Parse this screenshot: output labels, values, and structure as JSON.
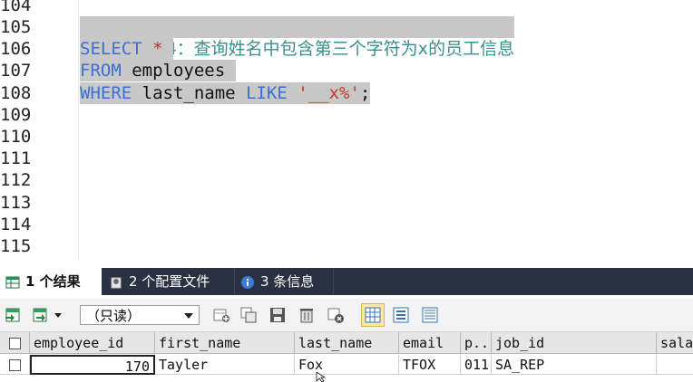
{
  "editor": {
    "line_numbers": [
      "104",
      "105",
      "106",
      "107",
      "108",
      "109",
      "110",
      "111",
      "112",
      "113",
      "114",
      "115"
    ],
    "lines": {
      "comment": "#案例4：查询姓名中包含第三个字符为x的员工信息",
      "select_kw": "SELECT",
      "select_star": "*",
      "from_kw": "FROM",
      "from_table": "employees",
      "where_kw": "WHERE",
      "where_col": "last_name",
      "like_kw": "LIKE",
      "like_str": "'__x%'",
      "semicolon": ";"
    }
  },
  "result_tabs": [
    {
      "label": "1 个结果",
      "icon": "table-result-icon",
      "active": true
    },
    {
      "label": "2 个配置文件",
      "icon": "profile-icon",
      "active": false
    },
    {
      "label": "3 条信息",
      "icon": "info-icon",
      "active": false
    }
  ],
  "toolbar": {
    "readonly_select": "（只读）",
    "icons": [
      "export-icon",
      "import-icon",
      "dropdown-icon",
      "add-row-icon",
      "copy-row-icon",
      "save-icon",
      "delete-icon",
      "cancel-icon",
      "grid-view-icon",
      "form-view-icon",
      "text-view-icon"
    ]
  },
  "grid": {
    "columns": [
      "employee_id",
      "first_name",
      "last_name",
      "email",
      "p..",
      "job_id",
      "sala"
    ],
    "rows": [
      [
        "170",
        "Tayler",
        "Fox",
        "TFOX",
        "011",
        "SA_REP",
        ""
      ]
    ]
  },
  "colors": {
    "tab_bar": "#2a3140",
    "selection": "#c8c8c8",
    "comment": "#3a8f8f",
    "keyword": "#3b6fd6",
    "string": "#c0392b"
  }
}
